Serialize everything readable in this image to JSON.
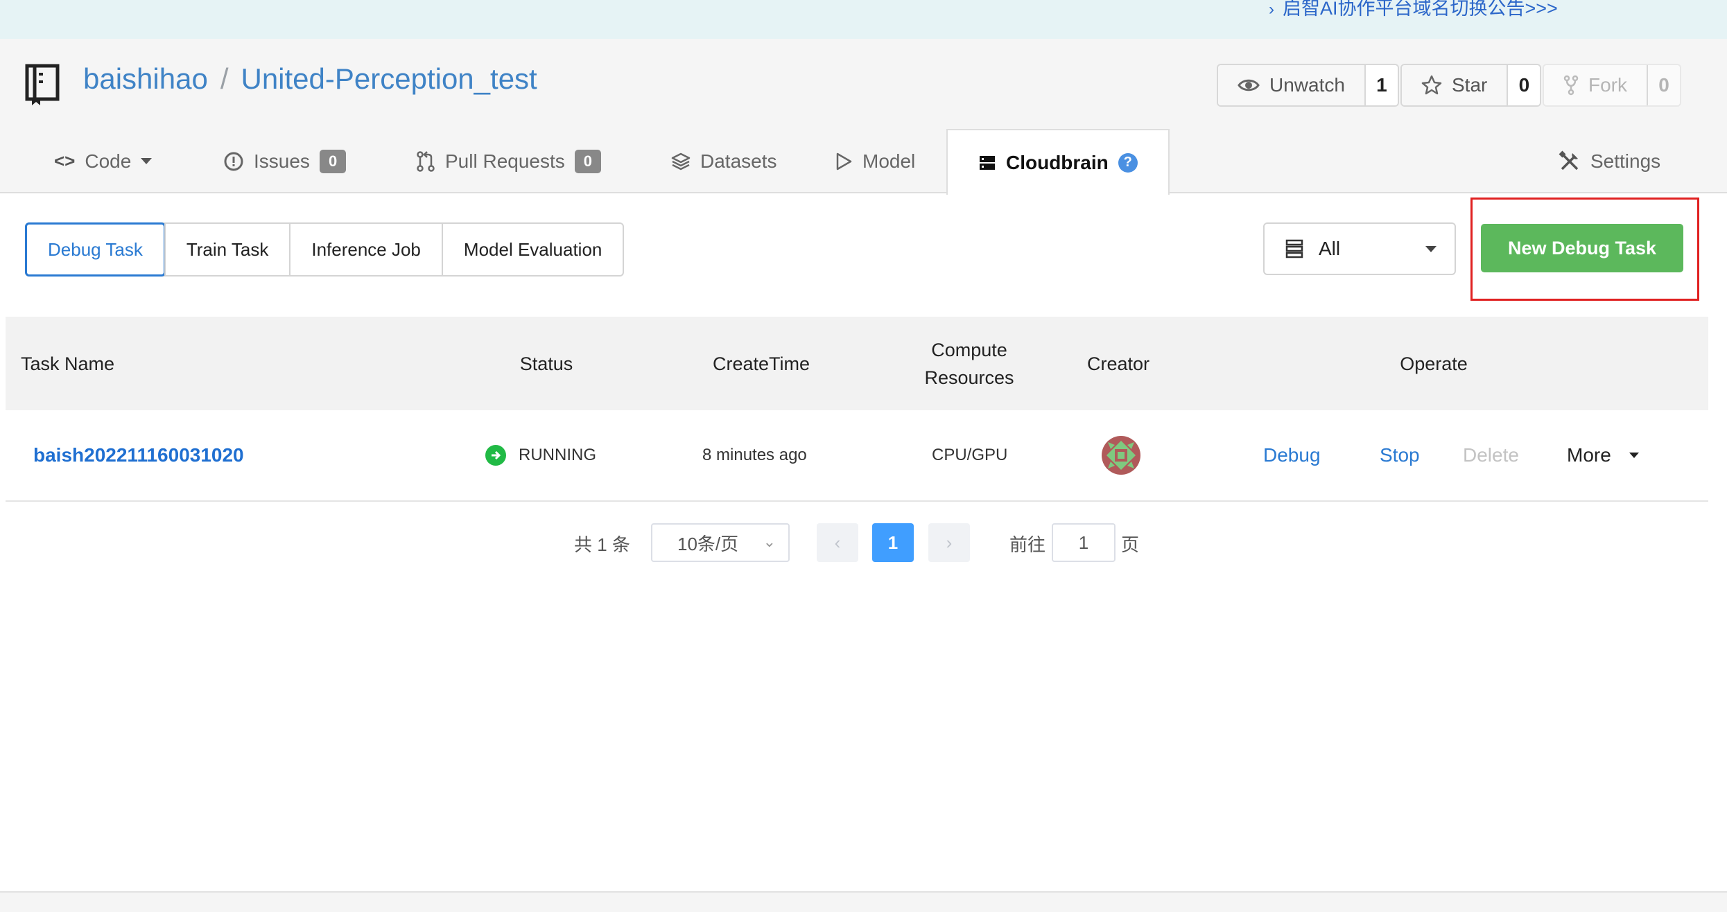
{
  "announcement": {
    "text": "启智AI协作平台域名切换公告>>>",
    "chevron": "›"
  },
  "repo": {
    "owner": "baishihao",
    "separator": "/",
    "name": "United-Perception_test"
  },
  "actions": {
    "unwatch": {
      "label": "Unwatch",
      "count": "1"
    },
    "star": {
      "label": "Star",
      "count": "0"
    },
    "fork": {
      "label": "Fork",
      "count": "0"
    }
  },
  "tabs": {
    "code": "Code",
    "issues": {
      "label": "Issues",
      "count": "0"
    },
    "pull_requests": {
      "label": "Pull Requests",
      "count": "0"
    },
    "datasets": "Datasets",
    "model": "Model",
    "cloudbrain": "Cloudbrain",
    "cloudbrain_help": "?",
    "settings": "Settings"
  },
  "subtabs": [
    "Debug Task",
    "Train Task",
    "Inference Job",
    "Model Evaluation"
  ],
  "filter": {
    "value": "All"
  },
  "new_task_label": "New Debug Task",
  "table": {
    "headers": {
      "task_name": "Task Name",
      "status": "Status",
      "create_time": "CreateTime",
      "compute_line1": "Compute",
      "compute_line2": "Resources",
      "creator": "Creator",
      "operate": "Operate"
    },
    "rows": [
      {
        "task_name": "baish202211160031020",
        "status": "RUNNING",
        "create_time": "8 minutes ago",
        "compute": "CPU/GPU",
        "ops": {
          "debug": "Debug",
          "stop": "Stop",
          "delete": "Delete",
          "more": "More"
        }
      }
    ]
  },
  "pagination": {
    "total": "共 1 条",
    "page_size": "10条/页",
    "prev": "‹",
    "current": "1",
    "next": "›",
    "goto_label": "前往",
    "goto_value": "1",
    "page_suffix": "页"
  },
  "colors": {
    "accent": "#2a7ad2",
    "success": "#5cb85c",
    "highlight": "#e02020"
  }
}
